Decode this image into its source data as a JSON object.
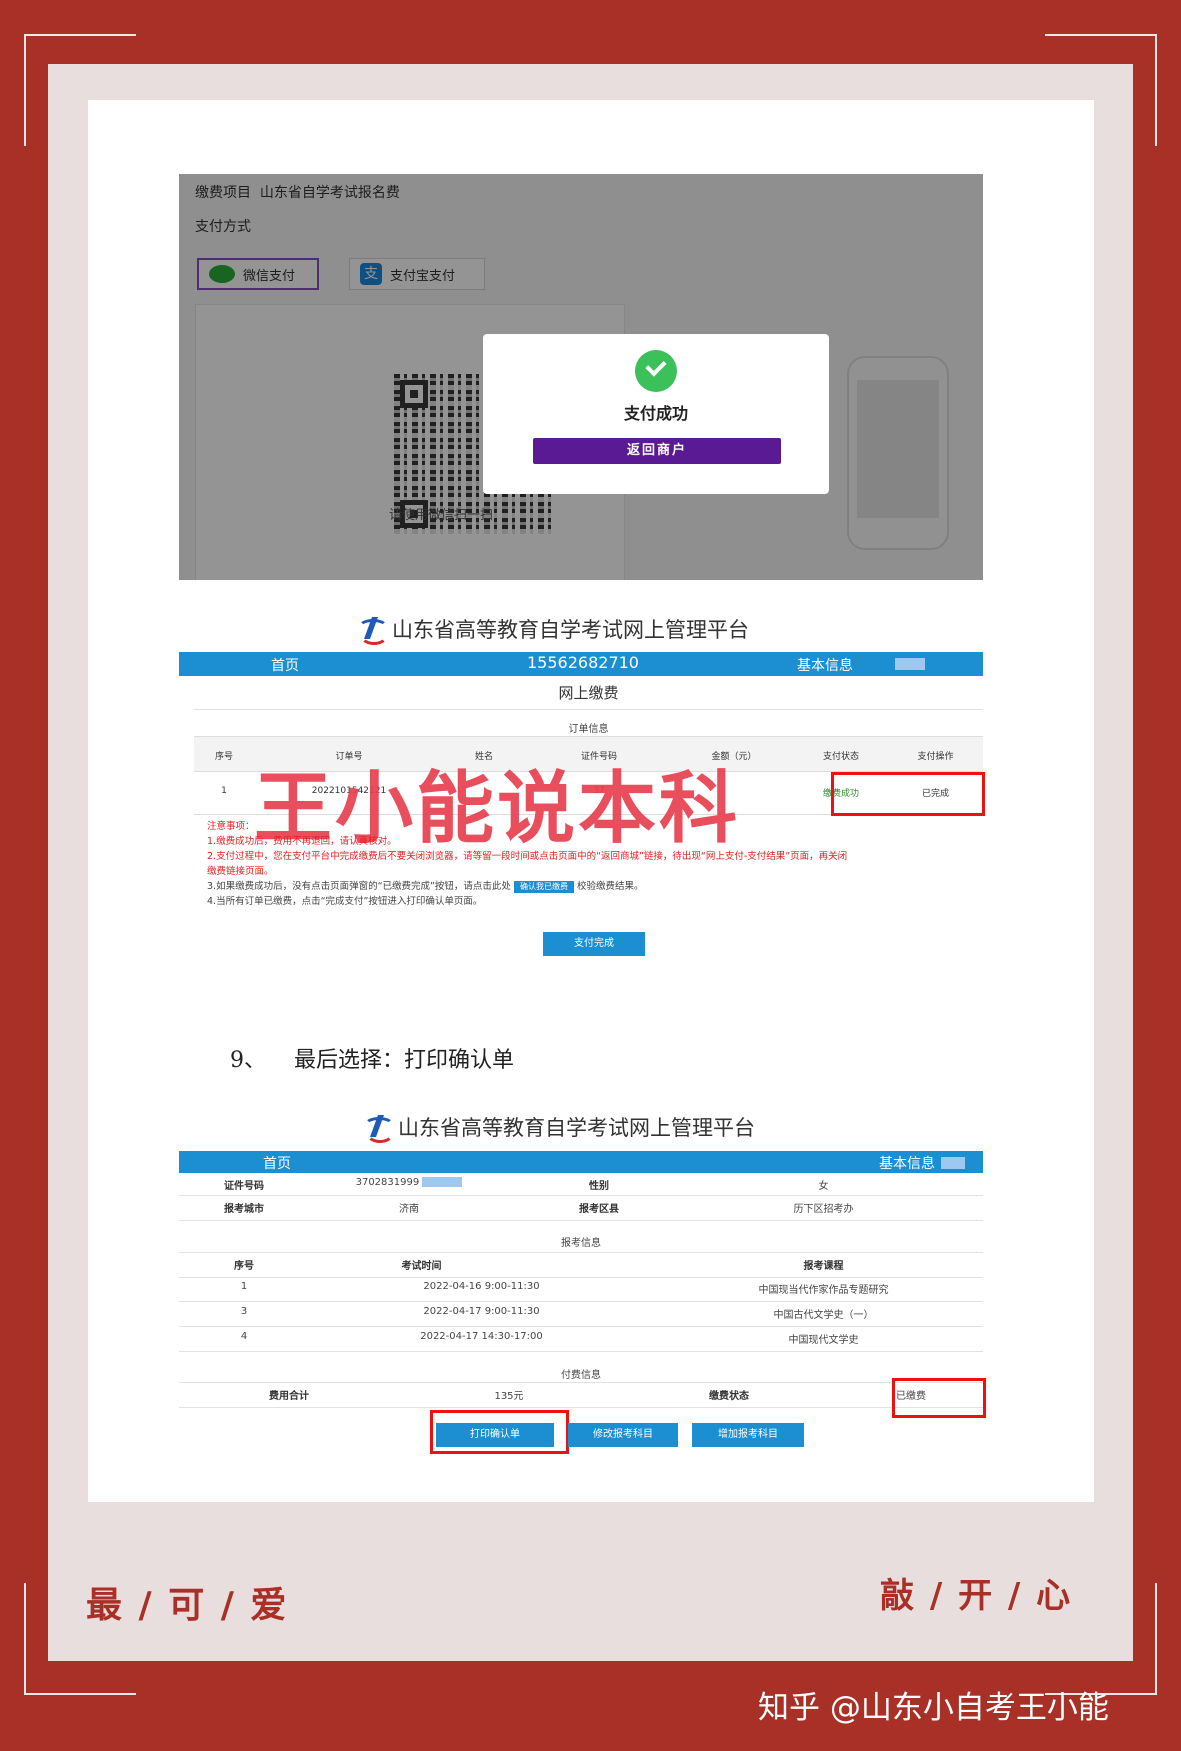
{
  "payment_page": {
    "item_label": "缴费项目",
    "item_value": "山东省自学考试报名费",
    "method_label": "支付方式",
    "wechat_label": "微信支付",
    "alipay_label": "支付宝支付",
    "qr_caption": "请使用微信扫一扫",
    "modal_title": "支付成功",
    "modal_button": "返回商户"
  },
  "platform": {
    "title": "山东省高等教育自学考试网上管理平台"
  },
  "order_page": {
    "nav_home": "首页",
    "nav_phone": "15562682710",
    "nav_basic": "基本信息",
    "page_title": "网上缴费",
    "section_title": "订单信息",
    "columns": [
      "序号",
      "订单号",
      "姓名",
      "证件号码",
      "金额（元）",
      "支付状态",
      "支付操作"
    ],
    "row": {
      "no": "1",
      "order": "2022101542121",
      "name": "",
      "id": "37",
      "amount": "",
      "status": "缴费成功",
      "action": "已完成"
    },
    "notes_title": "注意事项：",
    "notes": [
      "1.缴费成功后，费用不再退回，请认真核对。",
      "2.支付过程中，您在支付平台中完成缴费后不要关闭浏览器，请等留一段时间或点击页面中的“返回商城”链接，待出现“网上支付-支付结果”页面，再关闭",
      "缴费链接页面。",
      "3.如果缴费成功后，没有点击页面弹窗的“已缴费完成”按钮，请点击此处",
      "校验缴费结果。",
      "4.当所有订单已缴费，点击“完成支付”按钮进入打印确认单页面。"
    ],
    "confirm_paid_btn": "确认我已缴费",
    "finish_btn": "支付完成",
    "watermark": "王小能说本科"
  },
  "step": {
    "number": "9、",
    "text": "最后选择：打印确认单"
  },
  "confirm_page": {
    "nav_home": "首页",
    "nav_basic": "基本信息",
    "id_label": "证件号码",
    "id_value": "3702831999",
    "gender_label": "性别",
    "gender_value": "女",
    "city_label": "报考城市",
    "city_value": "济南",
    "district_label": "报考区县",
    "district_value": "历下区招考办",
    "exam_section": "报考信息",
    "exam_columns": [
      "序号",
      "考试时间",
      "报考课程"
    ],
    "exams": [
      {
        "no": "1",
        "time": "2022-04-16 9:00-11:30",
        "course": "中国现当代作家作品专题研究"
      },
      {
        "no": "3",
        "time": "2022-04-17 9:00-11:30",
        "course": "中国古代文学史（一）"
      },
      {
        "no": "4",
        "time": "2022-04-17 14:30-17:00",
        "course": "中国现代文学史"
      }
    ],
    "fee_section": "付费信息",
    "fee_label": "费用合计",
    "fee_value": "135元",
    "pay_status_label": "缴费状态",
    "pay_status_value": "已缴费",
    "print_btn": "打印确认单",
    "modify_btn": "修改报考科目",
    "add_btn": "增加报考科目"
  },
  "footer": {
    "left": "最 / 可 / 爱",
    "right": "敲 / 开 / 心",
    "credit": "知乎 @山东小自考王小能"
  },
  "colors": {
    "frame": "#a83026",
    "accent_blue": "#1b8fd2",
    "success_green": "#3cc05a",
    "modal_purple": "#5a1a94",
    "highlight_red": "#e11111"
  }
}
